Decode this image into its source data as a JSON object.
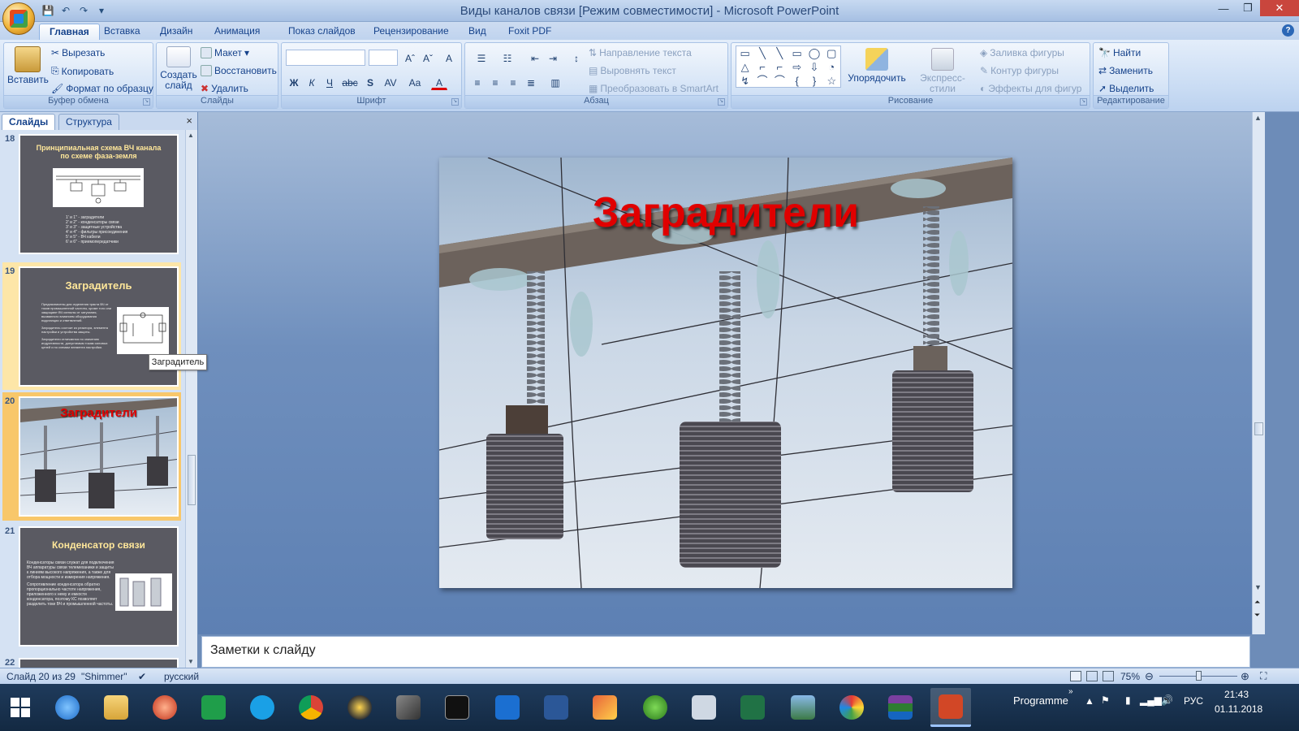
{
  "window": {
    "title": "Виды каналов связи [Режим совместимости] - Microsoft PowerPoint",
    "minimize": "—",
    "maximize": "❐",
    "close": "✕"
  },
  "qat": {
    "save": "💾",
    "undo": "↶",
    "redo": "↷",
    "more": "▾"
  },
  "tabs": [
    "Главная",
    "Вставка",
    "Дизайн",
    "Анимация",
    "Показ слайдов",
    "Рецензирование",
    "Вид",
    "Foxit PDF"
  ],
  "ribbon": {
    "clipboard": {
      "label": "Буфер обмена",
      "paste": "Вставить",
      "cut": "Вырезать",
      "copy": "Копировать",
      "format_painter": "Формат по образцу"
    },
    "slides": {
      "label": "Слайды",
      "new_slide": "Создать слайд",
      "layout": "Макет",
      "reset": "Восстановить",
      "delete": "Удалить"
    },
    "font": {
      "label": "Шрифт",
      "grow": "Aˆ",
      "shrink": "Aˇ",
      "clear": "A",
      "bold": "Ж",
      "italic": "К",
      "underline": "Ч",
      "strike": "abc",
      "shadow": "S",
      "spacing": "AV",
      "case": "Aa",
      "color": "A"
    },
    "paragraph": {
      "label": "Абзац",
      "text_direction": "Направление текста",
      "align_text": "Выровнять текст",
      "smartart": "Преобразовать в SmartArt"
    },
    "drawing": {
      "label": "Рисование",
      "arrange": "Упорядочить",
      "quick_styles": "Экспресс-стили",
      "shape_fill": "Заливка фигуры",
      "shape_outline": "Контур фигуры",
      "shape_effects": "Эффекты для фигур",
      "shapes": [
        "▭",
        "╲",
        "╲",
        "▭",
        "◯",
        "▢",
        "△",
        "⌐",
        "⌐",
        "⇨",
        "⇩",
        "◔",
        "↯",
        "⌒",
        "⌒",
        "{",
        "}",
        "☆"
      ]
    },
    "editing": {
      "label": "Редактирование",
      "find": "Найти",
      "replace": "Заменить",
      "select": "Выделить"
    }
  },
  "left_panel": {
    "tab_slides": "Слайды",
    "tab_outline": "Структура",
    "close": "×"
  },
  "thumbnails": [
    {
      "num": "18",
      "title": "Принципиальная схема ВЧ канала по схеме фаза-земля",
      "bullets": [
        "1' и 1'' - заградители",
        "2' и 2'' - конденсаторы связи",
        "3' и 3'' - защитные устройства",
        "4' и 4'' - фильтры присоединения",
        "5' и 5'' - ВЧ кабели",
        "6' и 6'' - приемопередатчики"
      ]
    },
    {
      "num": "19",
      "title": "Заградитель",
      "bullets": [
        "Предназначены для отделения тракта ВЧ от токов промышленной частоты, кроме того они защищают ВЧ сигналы от затухания, вызванного влиянием оборудования подстанции и ответвлений.",
        "Заградитель состоит из реактора, элемента настройки и устройства защиты.",
        "Заградители отличаются по значению индуктивности, допустимым токам силовых цепей и по схемам элемента настройки."
      ]
    },
    {
      "num": "20",
      "title": "Заградители"
    },
    {
      "num": "21",
      "title": "Конденсатор связи",
      "bullets": [
        "Конденсаторы связи служат для подключения ВЧ аппаратуры связи телемеханики и защиты к линиям высокого напряжения, а также для отбора мощности и измерения напряжения.",
        "Сопротивление конденсатора обратно пропорционально частоте напряжения, приложенного к нему и емкости конденсатора, поэтому КС позволяет разделить токи ВЧ и промышленной частоты."
      ]
    },
    {
      "num": "22"
    }
  ],
  "tooltip": "Заградитель",
  "slide": {
    "title": "Заградители"
  },
  "notes_placeholder": "Заметки к слайду",
  "status": {
    "slide_counter": "Слайд 20 из 29",
    "theme": "\"Shimmer\"",
    "language": "русский",
    "zoom": "75%",
    "zoom_fraction": 0.5
  },
  "taskbar": {
    "programme": "Programme",
    "lang": "РУС",
    "time": "21:43",
    "date": "01.11.2018"
  },
  "colors": {
    "title_red": "#e00000",
    "ribbon_blue": "#15428b",
    "selected_thumb": "#f8c76a"
  }
}
